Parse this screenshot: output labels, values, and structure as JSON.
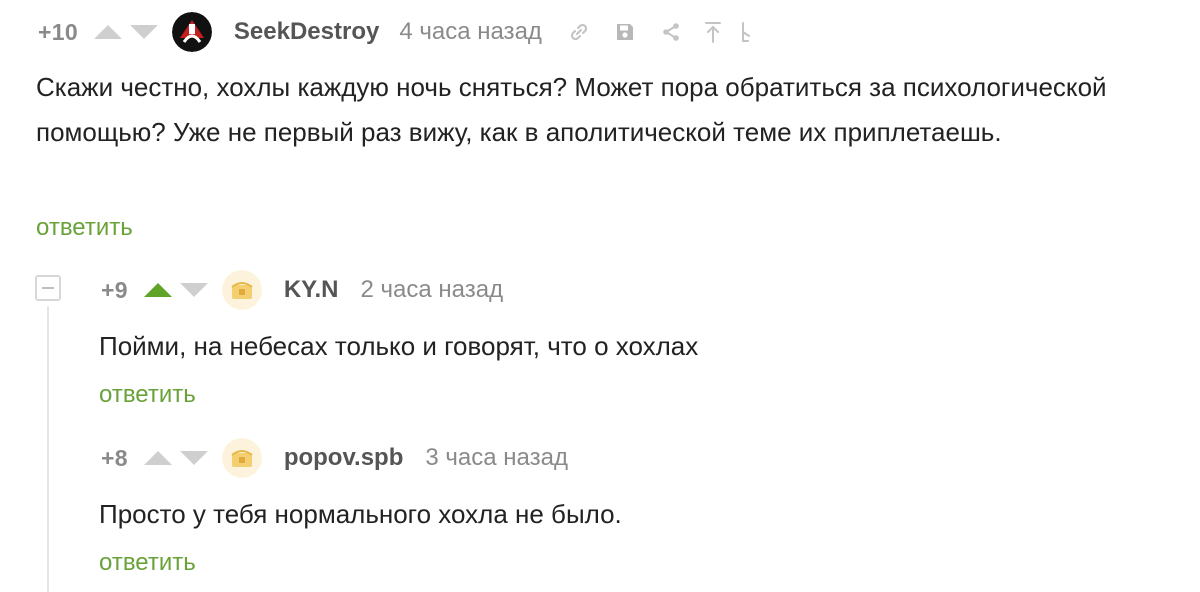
{
  "comments": [
    {
      "rating": "+10",
      "username": "SeekDestroy",
      "time": "4 часа назад",
      "text": "Скажи честно, хохлы каждую ночь сняться? Может пора обратиться за психологической помощью? Уже не первый раз вижу, как в аполитической теме их приплетаешь.",
      "reply": "ответить",
      "tools": [
        "link-icon",
        "save-icon",
        "share-icon",
        "scroll-to-parent-icon",
        "branch-icon"
      ]
    },
    {
      "rating": "+9",
      "username": "KY.N",
      "time": "2 часа назад",
      "text": "Пойми, на небесах только и говорят, что о хохлах",
      "reply": "ответить",
      "upvoted": true
    },
    {
      "rating": "+8",
      "username": "popov.spb",
      "time": "3 часа назад",
      "text": "Просто у тебя нормального хохла не было.",
      "reply": "ответить"
    }
  ],
  "colors": {
    "reply_link": "#6aa23a",
    "vote_active": "#5fa327",
    "vote_inactive": "#cfcfcf",
    "meta_gray": "#8a8a8a",
    "username": "#555555"
  }
}
